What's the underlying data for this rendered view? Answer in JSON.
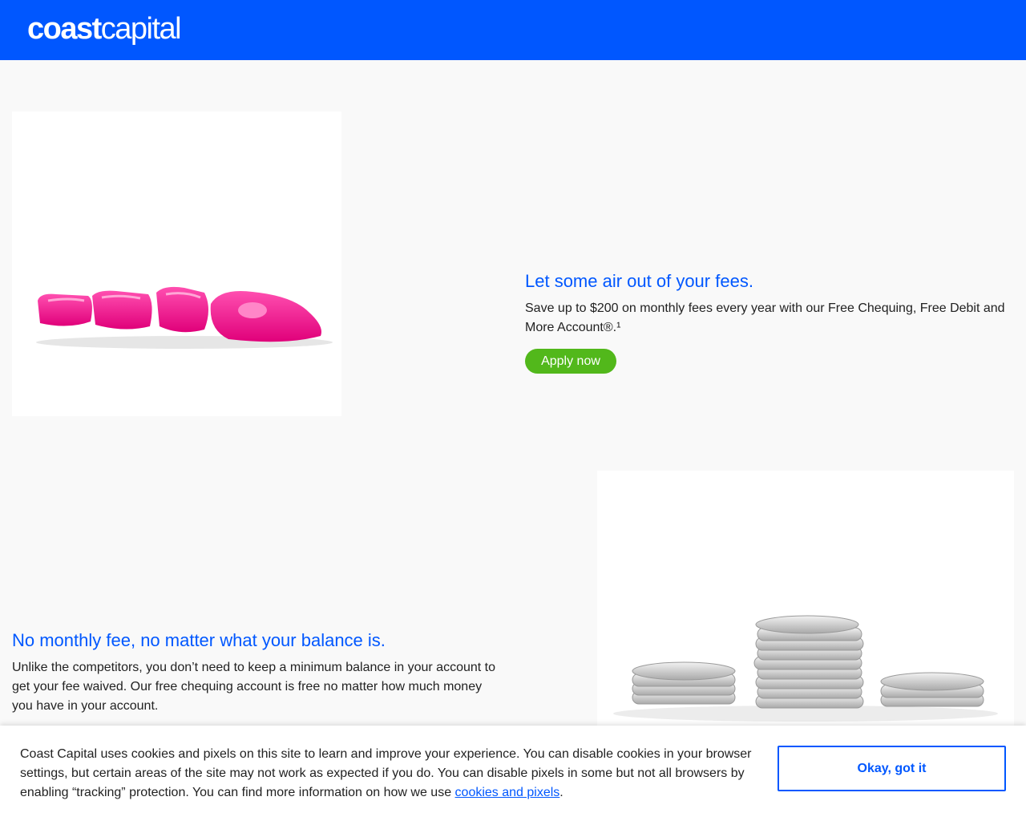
{
  "header": {
    "logo_bold": "coast",
    "logo_light": "capital",
    "brand_color": "#0057ff"
  },
  "section1": {
    "image_icon": "deflated-fees-balloon-letters",
    "title": "Let some air out of your fees.",
    "body": "Save up to $200 on monthly fees every year with our Free Chequing, Free Debit and More Account®.¹",
    "apply_label": "Apply now",
    "apply_color": "#52b81b"
  },
  "section2": {
    "image_icon": "stacked-silver-coins",
    "title": "No monthly fee, no matter what your balance is.",
    "body": "Unlike the competitors, you don’t need to keep a minimum balance in your account to get your fee waived. Our free chequing account is free no matter how much money you have in your account."
  },
  "cookie_banner": {
    "text": "Coast Capital uses cookies and pixels on this site to learn and improve your experience. You can disable cookies in your browser settings, but certain areas of the site may not work as expected if you do. You can disable pixels in some but not all browsers by enabling “tracking” protection. You can find more information on how we use ",
    "link_label": "cookies and pixels",
    "text_end": ".",
    "okay_label": "Okay, got it"
  }
}
